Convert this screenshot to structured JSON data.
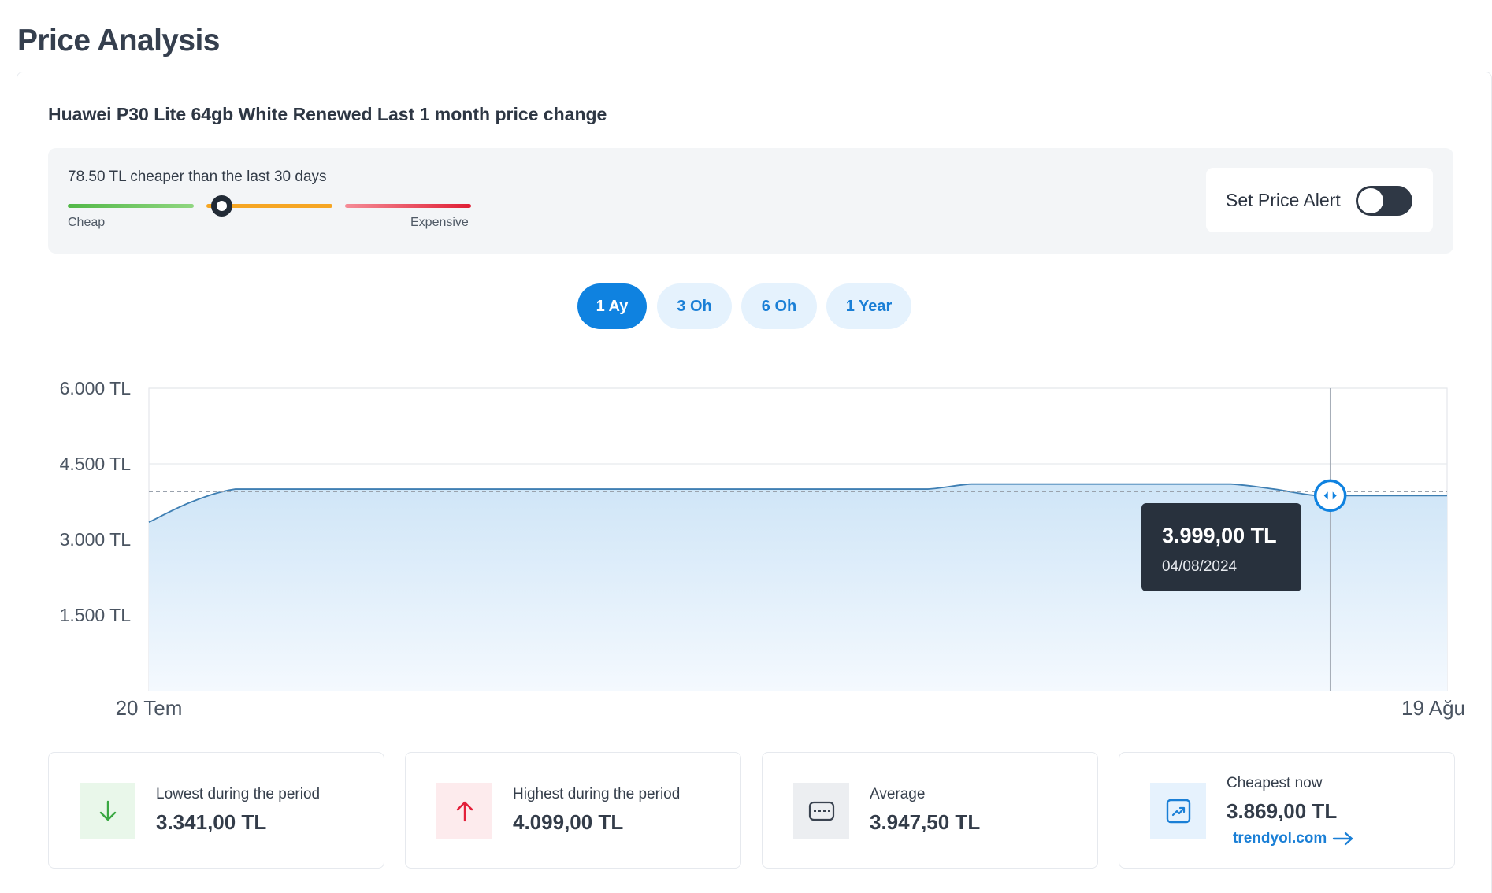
{
  "page": {
    "title": "Price Analysis"
  },
  "product": {
    "title": "Huawei P30 Lite 64gb White Renewed Last 1 month price change"
  },
  "summary": {
    "cheaper_text": "78.50 TL cheaper than the last 30 days",
    "cheap_label": "Cheap",
    "expensive_label": "Expensive",
    "indicator_level": 0.38
  },
  "alert": {
    "label": "Set Price Alert",
    "enabled": false
  },
  "ranges": [
    {
      "label": "1 Ay",
      "active": true
    },
    {
      "label": "3 Oh",
      "active": false
    },
    {
      "label": "6 Oh",
      "active": false
    },
    {
      "label": "1 Year",
      "active": false
    }
  ],
  "tooltip": {
    "price": "3.999,00 TL",
    "date": "04/08/2024"
  },
  "chart_data": {
    "type": "area",
    "y_ticks": [
      "6.000 TL",
      "4.500 TL",
      "3.000 TL",
      "1.500 TL"
    ],
    "y_tick_values": [
      6000,
      4500,
      3000,
      1500
    ],
    "x_tick_labels": [
      "20 Tem",
      "19 Ağu"
    ],
    "ylim": [
      0,
      6000
    ],
    "x_range_days": [
      0,
      30
    ],
    "x": [
      0,
      1,
      2,
      3,
      4,
      5,
      6,
      7,
      8,
      9,
      10,
      11,
      12,
      13,
      14,
      15,
      16,
      17,
      18,
      19,
      20,
      21,
      22,
      23,
      24,
      25,
      26,
      27,
      28,
      29,
      30
    ],
    "values": [
      3341,
      3750,
      3999,
      3999,
      3999,
      3999,
      3999,
      3999,
      3999,
      3999,
      3999,
      3999,
      3999,
      3999,
      3999,
      3999,
      3999,
      3999,
      3999,
      4099,
      4099,
      4099,
      4099,
      4099,
      4099,
      4099,
      3999,
      3869,
      3869,
      3869,
      3869
    ],
    "average": 3947.5,
    "highlight_x": 27.3,
    "grid": true
  },
  "stats": [
    {
      "label": "Lowest during the period",
      "value": "3.341,00 TL",
      "icon": "arrow-down-icon",
      "color": "#3aa843",
      "bg": "#e9f7ea"
    },
    {
      "label": "Highest during the period",
      "value": "4.099,00 TL",
      "icon": "arrow-up-icon",
      "color": "#e3203a",
      "bg": "#fdebed"
    },
    {
      "label": "Average",
      "value": "3.947,50 TL",
      "icon": "average-icon",
      "color": "#3a4350",
      "bg": "#eceef1"
    },
    {
      "label": "Cheapest now",
      "value": "3.869,00 TL",
      "link": "trendyol.com",
      "icon": "trend-chart-icon",
      "color": "#1a7fd6",
      "bg": "#e6f2fd"
    }
  ],
  "colors": {
    "accent": "#0f82e0",
    "line": "#3f7fb3",
    "dark": "#28313d"
  }
}
